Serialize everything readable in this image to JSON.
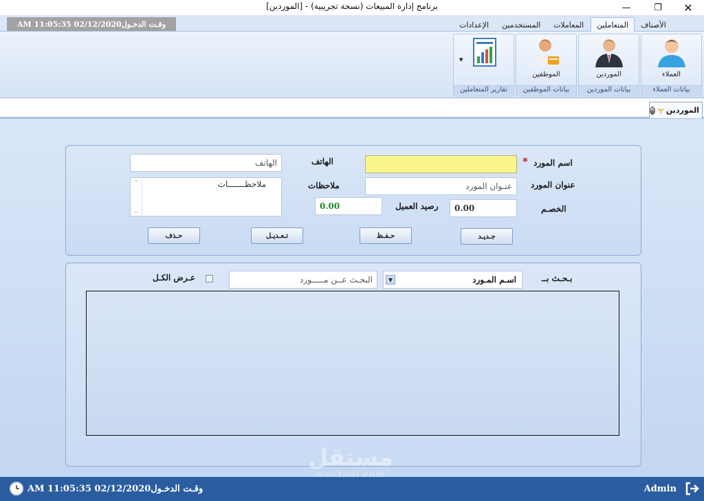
{
  "window": {
    "title": "برنامج إدارة المبيعات (نسخة تجريبية) - [الموردين]",
    "min_icon": "minimize-icon",
    "restore_icon": "restore-icon",
    "close_icon": "close-icon"
  },
  "ribbon": {
    "login_time": "وقـت الدخـول02/12/2020 11:05:35 AM",
    "tabs": [
      "الأصناف",
      "المتعاملين",
      "المعاملات",
      "المستخدمين",
      "الإعدادات"
    ],
    "active_tab": "المتعاملين",
    "groups": [
      {
        "button": "العملاء",
        "label": "بيانات العملاء",
        "icon": "customer-person-icon"
      },
      {
        "button": "الموردين",
        "label": "بيانات الموردين",
        "icon": "supplier-person-icon"
      },
      {
        "button": "الموظفين",
        "label": "بيانات الموظفين",
        "icon": "employee-person-icon"
      },
      {
        "button": "",
        "label": "تقارير المتعاملين",
        "icon": "report-chart-icon"
      }
    ]
  },
  "doc_tab": {
    "label": "الموردين"
  },
  "form": {
    "supplier_name_label": "اسم المورد",
    "required_mark": "*",
    "supplier_name_value": "",
    "phone_label": "الهاتف",
    "phone_value": "الهاتف",
    "address_label": "عنوان المورد",
    "address_value": "عنـوان المورد",
    "notes_label": "ملاحظات",
    "notes_value": "ملاحظـــــــات",
    "discount_label": "الخصـم",
    "discount_value": "0.00",
    "balance_label": "رصيد العميل",
    "balance_value": "0.00",
    "buttons": {
      "new": "جـديـد",
      "save": "حـفـظ",
      "edit": "تـعـديـل",
      "delete": "حـذف"
    }
  },
  "search": {
    "by_label": "بـحـث بــ",
    "field_selected": "اسـم المـورد",
    "input_value": "البحـث عــن مـــــورد",
    "show_all_label": "عـرض الكـل",
    "show_all_checked": false
  },
  "watermark": {
    "line1": "مستقل",
    "line2": "mostaql.com"
  },
  "status": {
    "login_time": "وقـت الدخـول02/12/2020 11:05:35 AM",
    "user": "Admin"
  },
  "colors": {
    "required_field_bg": "#fbf58d",
    "balance_text": "#1f8a1f",
    "statusbar_bg": "#2a5da0",
    "asterisk": "#d01818"
  }
}
